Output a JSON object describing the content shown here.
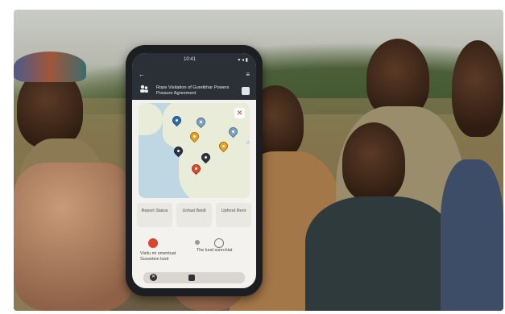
{
  "phone": {
    "status_time": "10:41",
    "status_right": "▾ ◂ ▮",
    "back_icon": "←",
    "menu_icon": "≡",
    "app_title": "Rope Visitation of Guretkhar Powers Possure Agreement",
    "close_icon": "✕",
    "actions": [
      {
        "label": "Report Status"
      },
      {
        "label": "Unfast Beidl"
      },
      {
        "label": "Upfond Rent"
      }
    ],
    "info": {
      "left_text": "Visitu mi omentuat Suvsetion lund",
      "right_text": "The lund sunrchlat"
    }
  },
  "colors": {
    "app_bar": "#2b2f36",
    "map_water": "#bfd7e3",
    "map_land": "#e9ecd9",
    "pin_colors": [
      "#2a6db5",
      "#f0a11a",
      "#e04a2a",
      "#2a3442",
      "#7aa3c6"
    ]
  }
}
